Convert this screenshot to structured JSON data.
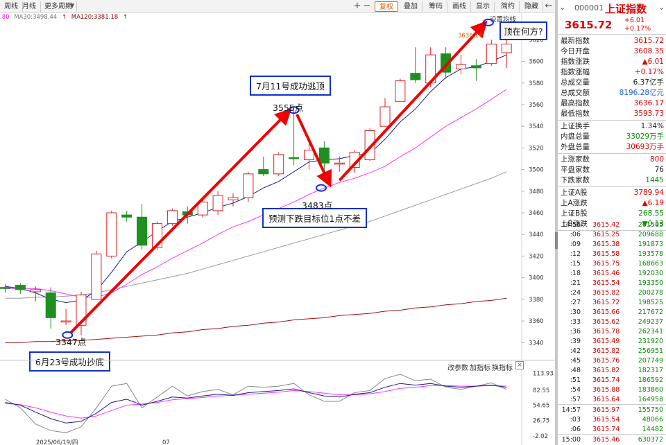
{
  "toolbar": {
    "left_tabs": [
      "周线",
      "月线",
      "更多周期"
    ],
    "right_buttons": [
      "复权",
      "叠加",
      "筹码",
      "画线",
      "显示",
      "简约",
      "隐藏"
    ],
    "icons": [
      "plus-icon",
      "minus-icon",
      "arrow-left-icon"
    ]
  },
  "ma_legend": [
    {
      "text": ".80",
      "color": "#ff00ff"
    },
    {
      "text": "MA30:3498.44",
      "color": "#777777"
    },
    {
      "text": "MA120:3381.18",
      "color": "#8b0000"
    }
  ],
  "chart_labels": {
    "settings": "设置均线",
    "high_marker": "3636.17",
    "date_left": "2025/06/19/四",
    "month_tick": "07"
  },
  "annotations": {
    "bottom_box": "6月23号成功抄底",
    "bottom_point": "3347点",
    "top_box": "7月11号成功逃顶",
    "top_point": "3555点",
    "mid_box": "预测下跌目标位1点不差",
    "mid_point": "3483点",
    "corner_box": "顶在何方?"
  },
  "indicator": {
    "buttons": [
      "改参数",
      "加指标",
      "换指标"
    ],
    "close": "×"
  },
  "chart_data": {
    "type": "candlestick",
    "y_axis_labels": [
      3340,
      3360,
      3380,
      3400,
      3420,
      3440,
      3460,
      3480,
      3500,
      3520,
      3540,
      3560,
      3580,
      3600,
      3620
    ],
    "ylim": [
      3328,
      3642
    ],
    "candles": [
      {
        "o": 3391,
        "h": 3394,
        "l": 3386,
        "c": 3390
      },
      {
        "o": 3393,
        "h": 3395,
        "l": 3385,
        "c": 3389
      },
      {
        "o": 3387,
        "h": 3392,
        "l": 3378,
        "c": 3389
      },
      {
        "o": 3386,
        "h": 3391,
        "l": 3353,
        "c": 3363
      },
      {
        "o": 3359,
        "h": 3371,
        "l": 3356,
        "c": 3360
      },
      {
        "o": 3356,
        "h": 3387,
        "l": 3347,
        "c": 3384
      },
      {
        "o": 3380,
        "h": 3425,
        "l": 3380,
        "c": 3422
      },
      {
        "o": 3420,
        "h": 3462,
        "l": 3418,
        "c": 3460
      },
      {
        "o": 3458,
        "h": 3462,
        "l": 3452,
        "c": 3456
      },
      {
        "o": 3456,
        "h": 3468,
        "l": 3426,
        "c": 3430
      },
      {
        "o": 3428,
        "h": 3452,
        "l": 3426,
        "c": 3450
      },
      {
        "o": 3450,
        "h": 3464,
        "l": 3448,
        "c": 3462
      },
      {
        "o": 3461,
        "h": 3466,
        "l": 3450,
        "c": 3458
      },
      {
        "o": 3458,
        "h": 3473,
        "l": 3456,
        "c": 3470
      },
      {
        "o": 3462,
        "h": 3480,
        "l": 3458,
        "c": 3476
      },
      {
        "o": 3472,
        "h": 3478,
        "l": 3466,
        "c": 3474
      },
      {
        "o": 3474,
        "h": 3498,
        "l": 3470,
        "c": 3496
      },
      {
        "o": 3500,
        "h": 3512,
        "l": 3494,
        "c": 3496
      },
      {
        "o": 3496,
        "h": 3516,
        "l": 3494,
        "c": 3514
      },
      {
        "o": 3511,
        "h": 3555,
        "l": 3504,
        "c": 3510
      },
      {
        "o": 3509,
        "h": 3524,
        "l": 3500,
        "c": 3518
      },
      {
        "o": 3520,
        "h": 3526,
        "l": 3490,
        "c": 3506
      },
      {
        "o": 3505,
        "h": 3512,
        "l": 3498,
        "c": 3506
      },
      {
        "o": 3502,
        "h": 3518,
        "l": 3497,
        "c": 3516
      },
      {
        "o": 3509,
        "h": 3538,
        "l": 3508,
        "c": 3536
      },
      {
        "o": 3540,
        "h": 3566,
        "l": 3540,
        "c": 3558
      },
      {
        "o": 3563,
        "h": 3584,
        "l": 3563,
        "c": 3582
      },
      {
        "o": 3589,
        "h": 3613,
        "l": 3580,
        "c": 3583
      },
      {
        "o": 3580,
        "h": 3613,
        "l": 3576,
        "c": 3606
      },
      {
        "o": 3607,
        "h": 3613,
        "l": 3584,
        "c": 3590
      },
      {
        "o": 3593,
        "h": 3606,
        "l": 3588,
        "c": 3597
      },
      {
        "o": 3596,
        "h": 3602,
        "l": 3582,
        "c": 3594
      },
      {
        "o": 3598,
        "h": 3620,
        "l": 3596,
        "c": 3616
      },
      {
        "o": 3608,
        "h": 3636,
        "l": 3594,
        "c": 3616
      }
    ],
    "ma5": [
      3392,
      3390,
      3386,
      3380,
      3377,
      3379,
      3388,
      3405,
      3424,
      3433,
      3443,
      3452,
      3456,
      3460,
      3465,
      3469,
      3475,
      3483,
      3489,
      3498,
      3507,
      3509,
      3510,
      3513,
      3515,
      3528,
      3544,
      3556,
      3572,
      3585,
      3593,
      3595,
      3600,
      3606
    ],
    "ma10": [
      3390,
      3390,
      3390,
      3388,
      3385,
      3382,
      3382,
      3386,
      3394,
      3403,
      3410,
      3418,
      3425,
      3432,
      3440,
      3447,
      3452,
      3458,
      3464,
      3470,
      3477,
      3483,
      3488,
      3492,
      3497,
      3503,
      3512,
      3520,
      3530,
      3540,
      3548,
      3556,
      3565,
      3574
    ],
    "ma30": [
      3381,
      3381,
      3382,
      3382,
      3383,
      3384,
      3386,
      3389,
      3392,
      3395,
      3398,
      3401,
      3404,
      3408,
      3412,
      3416,
      3420,
      3424,
      3428,
      3432,
      3436,
      3440,
      3444,
      3448,
      3452,
      3457,
      3462,
      3467,
      3472,
      3477,
      3482,
      3487,
      3492,
      3498
    ],
    "ma120": [
      3340,
      3340,
      3341,
      3341,
      3342,
      3342,
      3343,
      3344,
      3345,
      3346,
      3347,
      3349,
      3350,
      3352,
      3353,
      3355,
      3356,
      3358,
      3359,
      3361,
      3362,
      3363,
      3365,
      3366,
      3367,
      3369,
      3370,
      3372,
      3373,
      3375,
      3376,
      3378,
      3379,
      3381
    ],
    "indicator_y_labels": [
      "113.93",
      "82.55",
      "54.65",
      "26.75",
      "-2.02"
    ],
    "indicator_ylim": [
      -2,
      126
    ],
    "ind_k": [
      60,
      55,
      42,
      30,
      22,
      25,
      40,
      60,
      66,
      55,
      62,
      70,
      68,
      72,
      75,
      73,
      78,
      80,
      82,
      85,
      78,
      72,
      70,
      75,
      78,
      88,
      95,
      92,
      95,
      90,
      88,
      90,
      92,
      88
    ],
    "ind_d": [
      58,
      56,
      50,
      42,
      35,
      31,
      35,
      45,
      55,
      57,
      60,
      65,
      67,
      69,
      72,
      73,
      75,
      77,
      79,
      82,
      80,
      77,
      74,
      74,
      76,
      80,
      86,
      88,
      91,
      91,
      90,
      90,
      91,
      90
    ],
    "ind_j": [
      66,
      50,
      20,
      8,
      4,
      15,
      50,
      90,
      95,
      50,
      70,
      90,
      72,
      80,
      84,
      74,
      90,
      88,
      90,
      95,
      74,
      62,
      62,
      78,
      82,
      104,
      112,
      100,
      103,
      88,
      84,
      90,
      96,
      84
    ]
  },
  "quote": {
    "code": "000001",
    "name": "上证指数",
    "price": "3615.72",
    "change": "+6.01",
    "change_pct": "+0.17%"
  },
  "stats": [
    {
      "k": "最新指数",
      "v": "3615.72",
      "c": "red"
    },
    {
      "k": "今日开盘",
      "v": "3608.35",
      "c": "red"
    },
    {
      "k": "指数涨跌",
      "v": "▲6.01",
      "c": "red"
    },
    {
      "k": "指数涨幅",
      "v": "+0.17%",
      "c": "red"
    },
    {
      "k": "总成交量",
      "v": "6.37亿手",
      "c": "dark"
    },
    {
      "k": "总成交额",
      "v": "8196.28亿元",
      "c": "blue"
    },
    {
      "k": "最高指数",
      "v": "3636.17",
      "c": "red"
    },
    {
      "k": "最低指数",
      "v": "3593.73",
      "c": "red"
    }
  ],
  "stats2": [
    {
      "k": "上证换手",
      "v": "1.34%",
      "c": "dark"
    },
    {
      "k": "内盘总量",
      "v": "33029万手",
      "c": "green"
    },
    {
      "k": "外盘总量",
      "v": "30693万手",
      "c": "red"
    }
  ],
  "stats3": [
    {
      "k": "上涨家数",
      "v": "800",
      "c": "red"
    },
    {
      "k": "平盘家数",
      "v": "76",
      "c": "dark"
    },
    {
      "k": "下跌家数",
      "v": "1445",
      "c": "green"
    }
  ],
  "stats4": [
    {
      "k": "上证A股",
      "v": "3789.94",
      "c": "red"
    },
    {
      "k": "上A涨跌",
      "v": "▲6.19",
      "c": "red"
    },
    {
      "k": "上证B股",
      "v": "268.55",
      "c": "green"
    },
    {
      "k": "上B涨跌",
      "v": "▼0.13",
      "c": "green"
    }
  ],
  "ticks": [
    {
      "t": "14:56",
      "p": "3615.42",
      "v": "261505"
    },
    {
      "t": ":06",
      "p": "3615.25",
      "v": "209688"
    },
    {
      "t": ":09",
      "p": "3615.38",
      "v": "191873"
    },
    {
      "t": ":12",
      "p": "3615.58",
      "v": "193578"
    },
    {
      "t": ":15",
      "p": "3615.75",
      "v": "168663"
    },
    {
      "t": ":18",
      "p": "3615.46",
      "v": "192030"
    },
    {
      "t": ":21",
      "p": "3615.54",
      "v": "193350"
    },
    {
      "t": ":24",
      "p": "3615.82",
      "v": "200278"
    },
    {
      "t": ":27",
      "p": "3615.72",
      "v": "198525"
    },
    {
      "t": ":30",
      "p": "3615.66",
      "v": "217672"
    },
    {
      "t": ":33",
      "p": "3615.62",
      "v": "249237"
    },
    {
      "t": ":36",
      "p": "3615.78",
      "v": "262341"
    },
    {
      "t": ":39",
      "p": "3615.49",
      "v": "231920"
    },
    {
      "t": ":42",
      "p": "3615.82",
      "v": "256951"
    },
    {
      "t": ":45",
      "p": "3615.76",
      "v": "207749"
    },
    {
      "t": ":48",
      "p": "3615.82",
      "v": "182317"
    },
    {
      "t": ":51",
      "p": "3615.74",
      "v": "186592"
    },
    {
      "t": ":54",
      "p": "3615.88",
      "v": "183860"
    },
    {
      "t": ":57",
      "p": "3615.64",
      "v": "164958"
    },
    {
      "t": "14:57",
      "p": "3615.97",
      "v": "155750"
    },
    {
      "t": ":03",
      "p": "3615.54",
      "v": "48066"
    },
    {
      "t": ":06",
      "p": "3615.74",
      "v": "14482"
    },
    {
      "t": "15:00",
      "p": "3615.46",
      "v": "630372"
    }
  ]
}
